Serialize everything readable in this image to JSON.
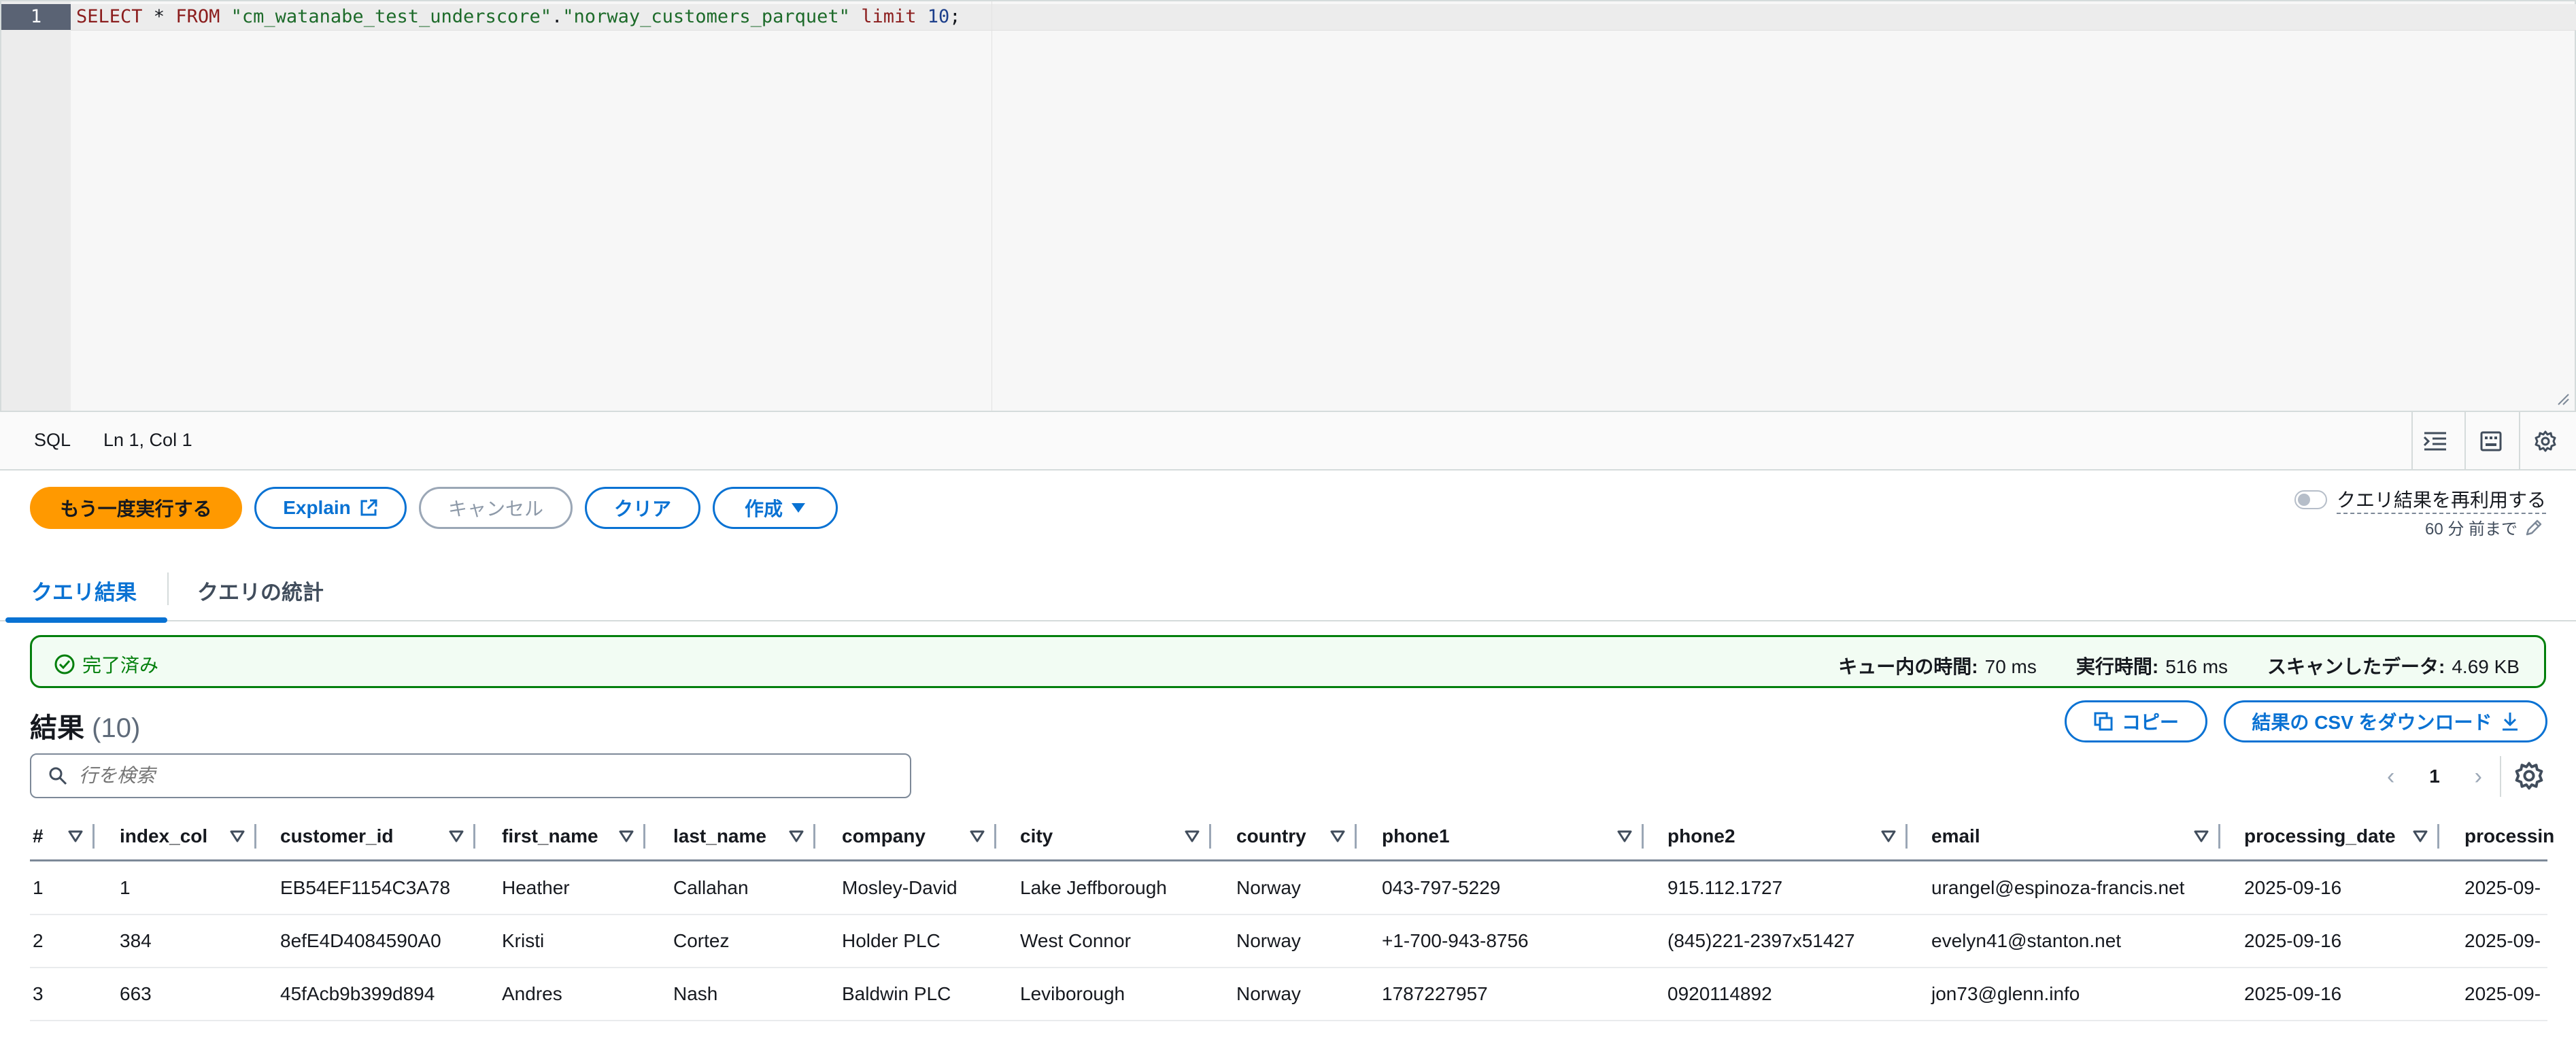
{
  "editor": {
    "line_number": "1",
    "sql_parts": {
      "select": "SELECT",
      "star": " * ",
      "from": "FROM",
      "db": "\"cm_watanabe_test_underscore\"",
      "dot": ".",
      "table": "\"norway_customers_parquet\"",
      "limit": "limit",
      "count": "10",
      "semi": ";"
    }
  },
  "status_bar": {
    "language": "SQL",
    "cursor": "Ln 1, Col 1",
    "icons": [
      "indent-icon",
      "keyboard-icon",
      "gear-icon"
    ]
  },
  "toolbar": {
    "run_again": "もう一度実行する",
    "explain": "Explain",
    "cancel": "キャンセル",
    "clear": "クリア",
    "create": "作成",
    "reuse_label": "クエリ結果を再利用する",
    "reuse_sub": "60 分 前まで",
    "reuse_enabled": false
  },
  "tabs": [
    {
      "label": "クエリ結果",
      "active": true
    },
    {
      "label": "クエリの統計",
      "active": false
    }
  ],
  "alert": {
    "status": "完了済み",
    "queue_label": "キュー内の時間:",
    "queue_value": "70 ms",
    "exec_label": "実行時間:",
    "exec_value": "516 ms",
    "scan_label": "スキャンしたデータ:",
    "scan_value": "4.69 KB",
    "color": "#037f0c"
  },
  "results": {
    "title": "結果",
    "count": "(10)",
    "copy_label": "コピー",
    "download_label": "結果の CSV をダウンロード",
    "search_placeholder": "行を検索",
    "page": "1"
  },
  "table": {
    "columns": [
      "#",
      "index_col",
      "customer_id",
      "first_name",
      "last_name",
      "company",
      "city",
      "country",
      "phone1",
      "phone2",
      "email",
      "processing_date",
      "processin"
    ],
    "rows": [
      [
        "1",
        "1",
        "EB54EF1154C3A78",
        "Heather",
        "Callahan",
        "Mosley-David",
        "Lake Jeffborough",
        "Norway",
        "043-797-5229",
        "915.112.1727",
        "urangel@espinoza-francis.net",
        "2025-09-16",
        "2025-09-"
      ],
      [
        "2",
        "384",
        "8efE4D4084590A0",
        "Kristi",
        "Cortez",
        "Holder PLC",
        "West Connor",
        "Norway",
        "+1-700-943-8756",
        "(845)221-2397x51427",
        "evelyn41@stanton.net",
        "2025-09-16",
        "2025-09-"
      ],
      [
        "3",
        "663",
        "45fAcb9b399d894",
        "Andres",
        "Nash",
        "Baldwin PLC",
        "Leviborough",
        "Norway",
        "1787227957",
        "0920114892",
        "jon73@glenn.info",
        "2025-09-16",
        "2025-09-"
      ]
    ]
  }
}
